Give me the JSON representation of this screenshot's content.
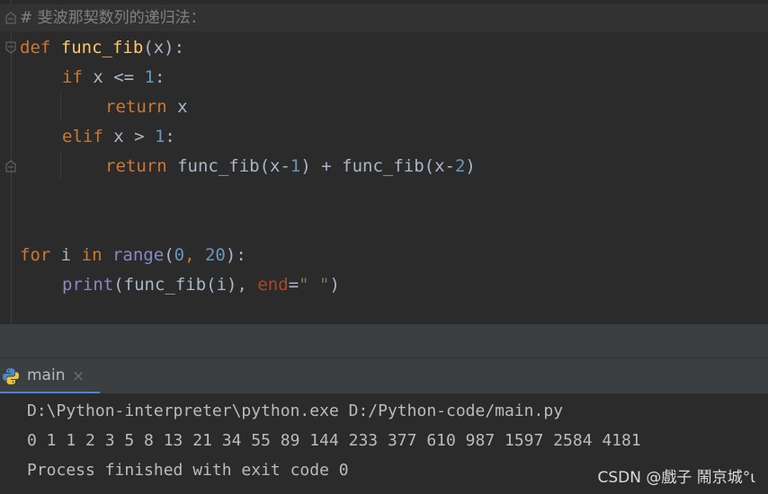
{
  "editor": {
    "comment": "# 斐波那契数列的递归法：",
    "def_kw": "def",
    "func_name": "func_fib",
    "param_def": "(x):",
    "if_kw": "if",
    "if_cond": " x <= ",
    "one_a": "1",
    "colon_a": ":",
    "return_kw_1": "return",
    "return_val_1": " x",
    "elif_kw": "elif",
    "elif_cond": " x > ",
    "one_b": "1",
    "colon_b": ":",
    "return_kw_2": "return",
    "ret2_a": " func_fib(x-",
    "ret2_one": "1",
    "ret2_b": ") + func_fib(x-",
    "ret2_two": "2",
    "ret2_c": ")",
    "for_kw": "for",
    "for_var": " i ",
    "in_kw": "in",
    "range_fn": " range",
    "range_open": "(",
    "range_zero": "0",
    "range_comma": ", ",
    "range_twenty": "20",
    "range_close": "):",
    "print_fn": "print",
    "print_args": "(func_fib(i), ",
    "end_param": "end",
    "eq": "=",
    "end_str": "\" \"",
    "print_close": ")"
  },
  "run_panel": {
    "tab_label": "main",
    "close_glyph": "×",
    "console_lines": [
      "D:\\Python-interpreter\\python.exe D:/Python-code/main.py",
      "0 1 1 2 3 5 8 13 21 34 55 89 144 233 377 610 987 1597 2584 4181",
      "Process finished with exit code 0"
    ]
  },
  "watermark": "CSDN @戲子   鬧京城°ι",
  "colors": {
    "background": "#2b2b2b",
    "keyword": "#cc7832",
    "function": "#ffc66d",
    "number": "#6897bb",
    "builtin": "#8888c6",
    "string": "#6a8759",
    "accent": "#4a88c7"
  }
}
